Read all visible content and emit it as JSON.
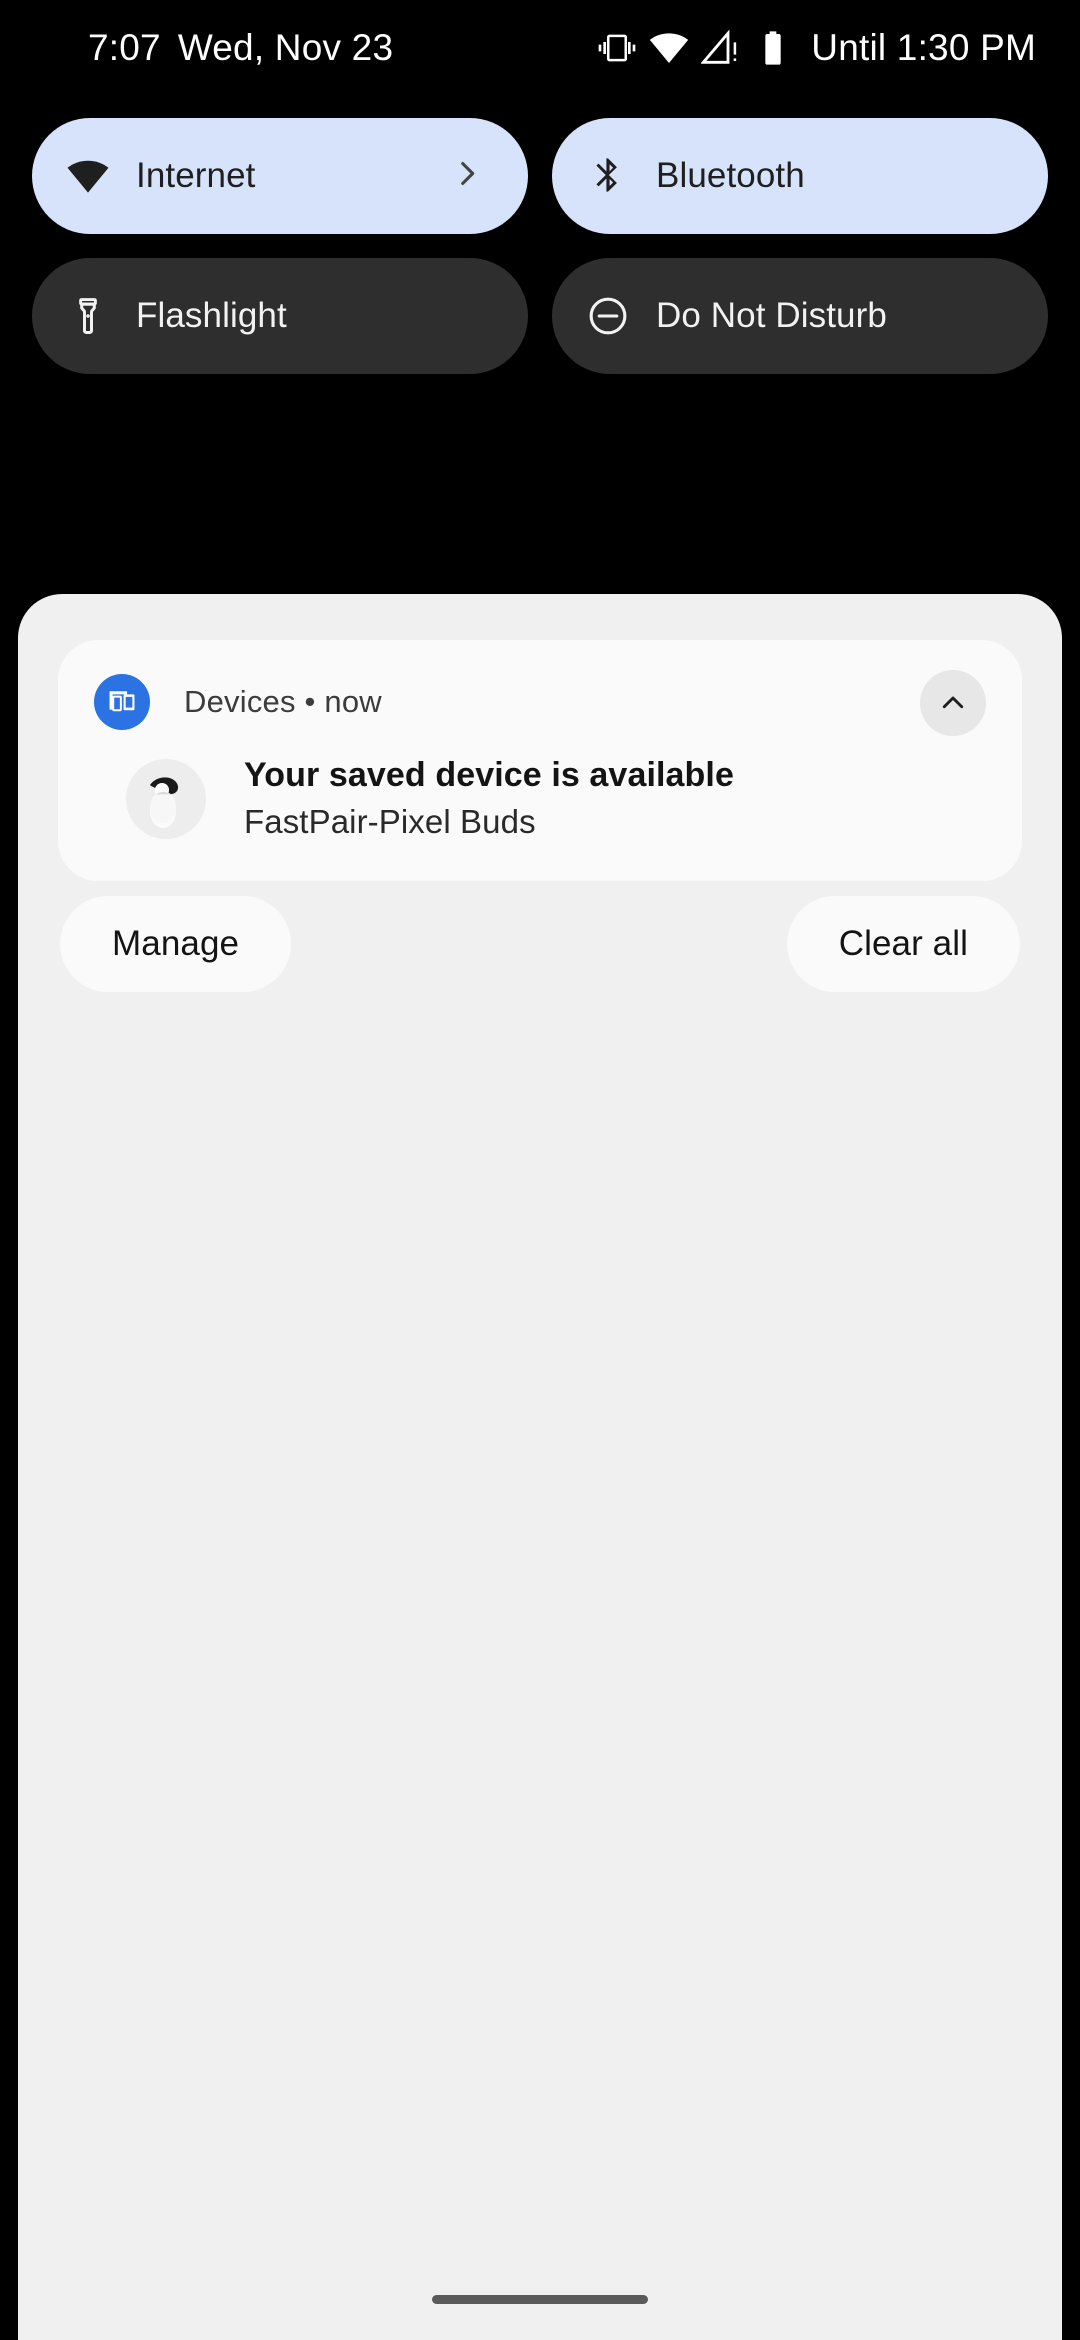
{
  "status_bar": {
    "time": "7:07",
    "date": "Wed, Nov 23",
    "dnd_until": "Until 1:30 PM",
    "icons": [
      "vibrate-icon",
      "wifi-icon",
      "signal-warning-icon",
      "battery-icon"
    ]
  },
  "quick_settings": {
    "tiles": [
      {
        "label": "Internet",
        "icon": "wifi-icon",
        "state": "active",
        "has_chevron": true
      },
      {
        "label": "Bluetooth",
        "icon": "bluetooth-icon",
        "state": "active",
        "has_chevron": false
      },
      {
        "label": "Flashlight",
        "icon": "flashlight-icon",
        "state": "inactive",
        "has_chevron": false
      },
      {
        "label": "Do Not Disturb",
        "icon": "do-not-disturb-icon",
        "state": "inactive",
        "has_chevron": false
      }
    ],
    "active_color": "#D6E3FB",
    "inactive_color": "#2E2E2E"
  },
  "notification": {
    "app_name": "Devices",
    "separator": "•",
    "time": "now",
    "title": "Your saved device is available",
    "subtitle": "FastPair-Pixel Buds",
    "app_icon": "devices-cast-icon",
    "app_icon_color": "#2B72E3",
    "expand_icon": "chevron-up-icon",
    "card_color": "#FAFAFA"
  },
  "footer": {
    "manage_label": "Manage",
    "clear_all_label": "Clear all"
  },
  "shade": {
    "background": "#F0F0F0"
  }
}
